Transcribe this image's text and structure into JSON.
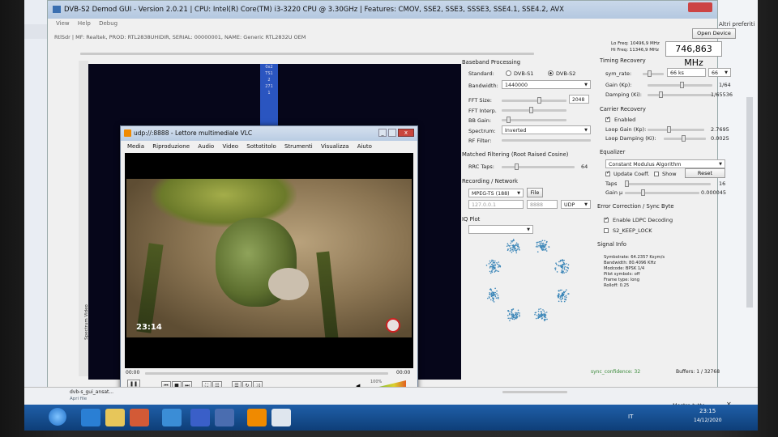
{
  "app": {
    "title": "DVB-S2 Demod GUI - Version 2.0.21 | CPU: Intel(R) Core(TM) i3-3220 CPU @ 3.30GHz | Features: CMOV, SSE2, SSE3, SSSE3, SSE4.1, SSE4.2, AVX",
    "menu": [
      "View",
      "Help",
      "Debug"
    ],
    "device_info": "RtlSdr | MF: Realtek, PROD: RTL2838UHIDIR, SERIAL: 00000001, NAME: Generic RTL2832U OEM",
    "open_device_label": "Open Device",
    "lo_freq": "Lo Freq: 10496,9 MHz",
    "hi_freq": "Hi Freq: 11346,9 MHz",
    "frequency": "746,863 MHz",
    "spectrum_vertical_label": "Spectrum Video"
  },
  "baseband": {
    "header": "Baseband Processing",
    "standard_label": "Standard:",
    "standard_opt1": "DVB-S1",
    "standard_opt2": "DVB-S2",
    "standard_selected": "DVB-S2",
    "bandwidth_label": "Bandwidth:",
    "bandwidth_value": "1440000",
    "fft_size_label": "FFT Size:",
    "fft_size_value": "2048",
    "fft_interp_label": "FFT Interp.",
    "bb_gain_label": "BB Gain:",
    "spectrum_label": "Spectrum:",
    "spectrum_value": "Inverted",
    "rf_filter_label": "RF Filter:"
  },
  "matched_filter": {
    "header": "Matched Filtering (Root Raised Cosine)",
    "rrc_taps_label": "RRC Taps:",
    "rrc_taps_value": "64"
  },
  "recording": {
    "header": "Recording / Network",
    "format": "MPEG-TS (188)",
    "file_label": "File",
    "ip": "127.0.0.1",
    "port": "8888",
    "protocol": "UDP"
  },
  "iq_plot": {
    "header": "IQ Plot"
  },
  "timing": {
    "header": "Timing Recovery",
    "sym_rate_label": "sym_rate:",
    "sym_rate_value": "66 ks",
    "sym_rate_select": "66",
    "gain_label": "Gain (Kp):",
    "gain_value": "1/64",
    "damping_label": "Damping (Ki):",
    "damping_value": "1/65536"
  },
  "carrier": {
    "header": "Carrier Recovery",
    "enabled_label": "Enabled",
    "loop_gain_label": "Loop Gain (Kp):",
    "loop_gain_value": "2.7695",
    "loop_damping_label": "Loop Damping (Ki):",
    "loop_damping_value": "0.0025"
  },
  "equalizer": {
    "header": "Equalizer",
    "algorithm": "Constant Modulus Algorithm",
    "update_label": "Update Coeff.",
    "show_label": "Show",
    "reset_label": "Reset",
    "taps_label": "Taps",
    "taps_value": "16",
    "gain_label": "Gain µ",
    "gain_value": "0.000045"
  },
  "error_correction": {
    "header": "Error Correction / Sync Byte",
    "ldpc_label": "Enable LDPC Decoding",
    "keep_lock_label": "S2_KEEP_LOCK"
  },
  "signal_info": {
    "header": "Signal Info",
    "lines": [
      "Symbolrate: 64.2357 Ksym/s",
      "Bandwidth: 80.4096 KHz",
      "Modcode: BPSK 1/4",
      "Pilot symbols: off",
      "Frame type: long",
      "Rolloff: 0.25"
    ]
  },
  "status": {
    "sync_confidence": "sync_confidence: 32",
    "buffers": "Buffers: 1 / 32768"
  },
  "vlc": {
    "title": "udp://:8888 - Lettore multimediale VLC",
    "menu": [
      "Media",
      "Riproduzione",
      "Audio",
      "Video",
      "Sottotitolo",
      "Strumenti",
      "Visualizza",
      "Aiuto"
    ],
    "timestamp_overlay": "23:14",
    "time_left": "00:00",
    "time_right": "00:00",
    "volume": "100%"
  },
  "download": {
    "file": "dvb-s_gui_ansat...",
    "action": "Apri file",
    "right": "Mostra tutto"
  },
  "browser": {
    "right_text": "Altri preferiti"
  },
  "taskbar": {
    "lang": "IT",
    "time": "23:15",
    "date": "14/12/2020"
  },
  "iq_points": {
    "count": 8
  }
}
